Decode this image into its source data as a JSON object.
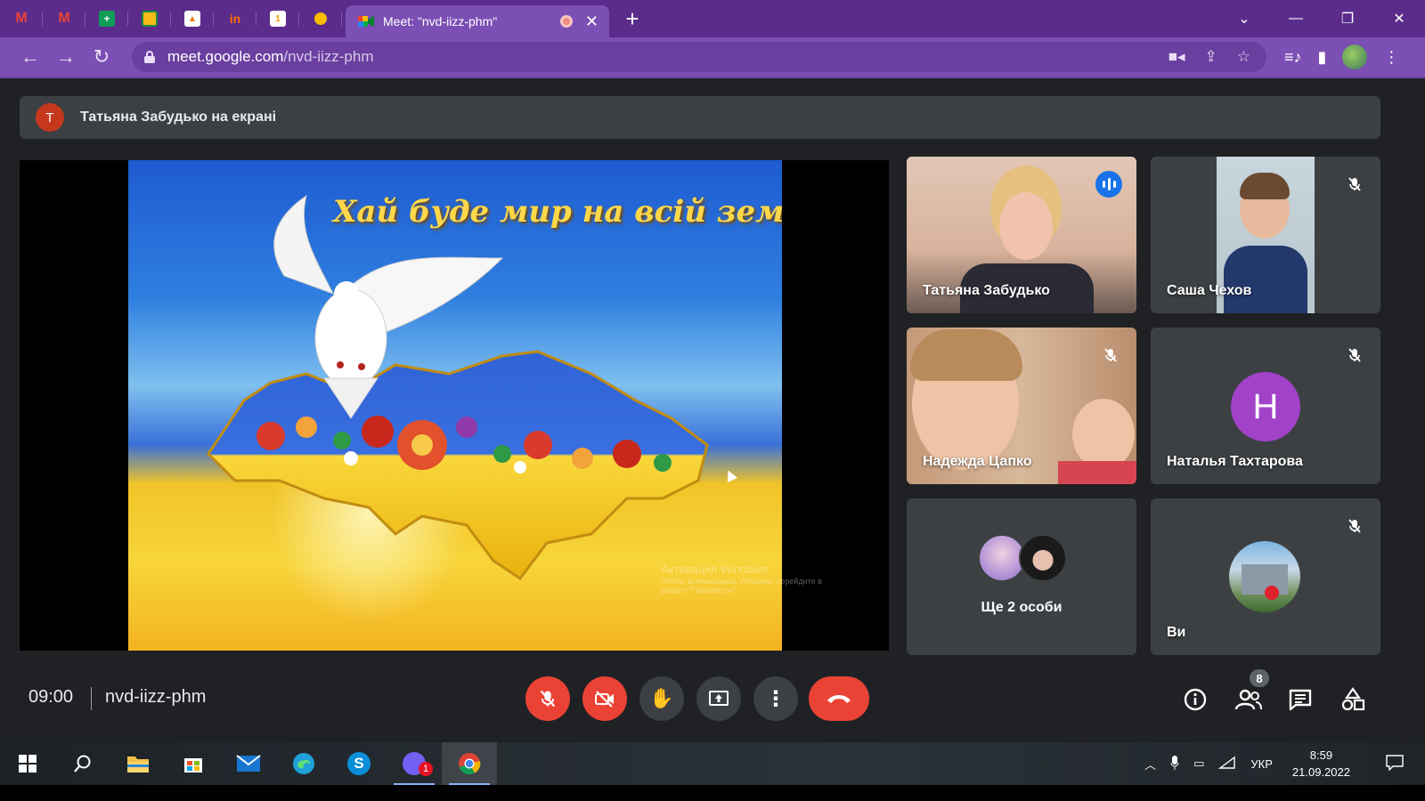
{
  "browser": {
    "pinned_tabs": [
      {
        "icon": "gmail-icon",
        "color": "#ea4335"
      },
      {
        "icon": "gmail-icon",
        "color": "#ea4335"
      },
      {
        "icon": "sheets-icon",
        "color": "#0f9d58"
      },
      {
        "icon": "classroom-icon",
        "color": "#f6bb18"
      },
      {
        "icon": "photo-icon",
        "color": "#ffffff"
      },
      {
        "icon": "in-icon",
        "color": "#ff6d00"
      },
      {
        "icon": "calendar-icon",
        "color": "#ffffff"
      },
      {
        "icon": "keep-icon",
        "color": "#fbbc04"
      }
    ],
    "active_tab_title": "Meet: \"nvd-iizz-phm\"",
    "new_tab_label": "+",
    "url_host": "meet.google.com",
    "url_path": "/nvd-iizz-phm"
  },
  "meet": {
    "presenting_avatar_letter": "T",
    "presenting_text": "Татьяна Забудько на екрані",
    "slide_text": "Хай буде мир на всій землі!",
    "watermark_title": "Активация Windows",
    "watermark_line1": "Чтобы активировать Windows, перейдите в",
    "watermark_line2": "раздел \"Параметры\".",
    "tiles": {
      "t1_name": "Татьяна Забудько",
      "t2_name": "Саша Чехов",
      "t3_name": "Надежда Цапко",
      "t4_name": "Наталья Тахтарова",
      "t4_letter": "Н",
      "t5_text": "Ще 2 особи",
      "t6_name": "Ви"
    },
    "time": "09:00",
    "meeting_code": "nvd-iizz-phm",
    "people_count": "8",
    "colors": {
      "accent": "#8ab4f8",
      "danger": "#ea4335",
      "tile_bg": "#3c4043",
      "bg": "#202124"
    }
  },
  "taskbar": {
    "language": "УКР",
    "time": "8:59",
    "date": "21.09.2022",
    "viber_badge": "1"
  }
}
